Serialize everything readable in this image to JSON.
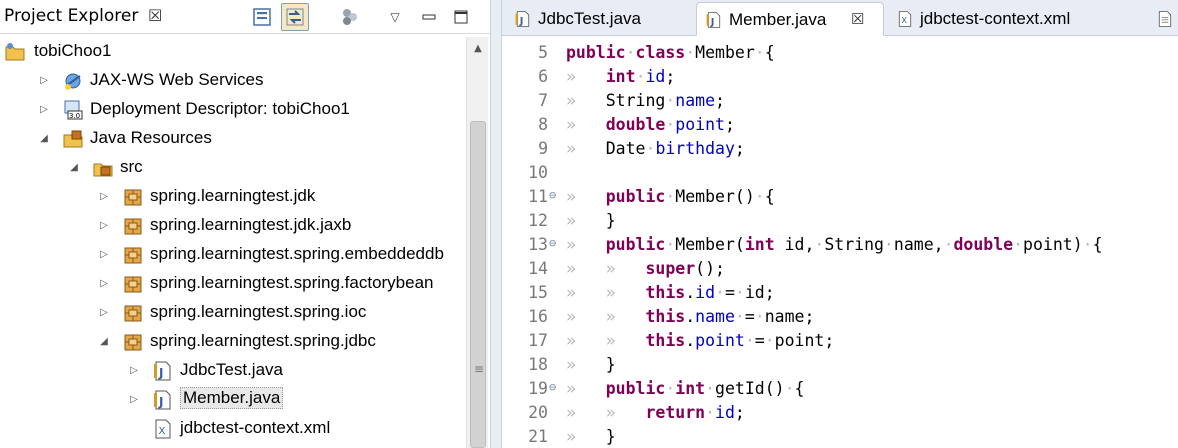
{
  "explorer": {
    "title": "Project Explorer",
    "close_glyph": "☒",
    "view_menu_glyph": "▽",
    "tree": [
      {
        "label": "tobiChoo1",
        "icon": "project-icon",
        "depth": 0,
        "twisty": "",
        "selected": false
      },
      {
        "label": "JAX-WS Web Services",
        "icon": "webservices-icon",
        "depth": 1,
        "twisty": "▷",
        "selected": false
      },
      {
        "label": "Deployment Descriptor: tobiChoo1",
        "icon": "deployment-descriptor-icon",
        "depth": 1,
        "twisty": "▷",
        "selected": false
      },
      {
        "label": "Java Resources",
        "icon": "java-resources-icon",
        "depth": 1,
        "twisty": "◢",
        "selected": false
      },
      {
        "label": "src",
        "icon": "source-folder-icon",
        "depth": 2,
        "twisty": "◢",
        "selected": false
      },
      {
        "label": "spring.learningtest.jdk",
        "icon": "package-icon",
        "depth": 3,
        "twisty": "▷",
        "selected": false
      },
      {
        "label": "spring.learningtest.jdk.jaxb",
        "icon": "package-icon",
        "depth": 3,
        "twisty": "▷",
        "selected": false
      },
      {
        "label": "spring.learningtest.spring.embeddeddb",
        "icon": "package-icon",
        "depth": 3,
        "twisty": "▷",
        "selected": false
      },
      {
        "label": "spring.learningtest.spring.factorybean",
        "icon": "package-icon",
        "depth": 3,
        "twisty": "▷",
        "selected": false
      },
      {
        "label": "spring.learningtest.spring.ioc",
        "icon": "package-icon",
        "depth": 3,
        "twisty": "▷",
        "selected": false
      },
      {
        "label": "spring.learningtest.spring.jdbc",
        "icon": "package-icon",
        "depth": 3,
        "twisty": "◢",
        "selected": false
      },
      {
        "label": "JdbcTest.java",
        "icon": "java-file-icon",
        "depth": 4,
        "twisty": "▷",
        "selected": false
      },
      {
        "label": "Member.java",
        "icon": "java-file-icon",
        "depth": 4,
        "twisty": "▷",
        "selected": true
      },
      {
        "label": "jdbctest-context.xml",
        "icon": "xml-file-icon",
        "depth": 4,
        "twisty": "",
        "selected": false
      }
    ],
    "scroll_glyph": "▲",
    "grip_glyph": "≡"
  },
  "editor": {
    "tabs": [
      {
        "label": "JdbcTest.java",
        "icon": "java-file-icon",
        "active": false
      },
      {
        "label": "Member.java",
        "icon": "java-file-icon",
        "active": true,
        "close_glyph": "☒"
      },
      {
        "label": "jdbctest-context.xml",
        "icon": "xml-file-icon",
        "active": false
      },
      {
        "label": "",
        "icon": "text-file-icon",
        "active": false
      }
    ],
    "lines": [
      {
        "number": "5",
        "fold": "",
        "tokens": [
          {
            "t": "kw",
            "s": "public"
          },
          {
            "t": "ws",
            "s": "·"
          },
          {
            "t": "kw",
            "s": "class"
          },
          {
            "t": "ws",
            "s": "·"
          },
          {
            "t": "plain",
            "s": "Member"
          },
          {
            "t": "ws",
            "s": "·"
          },
          {
            "t": "plain",
            "s": "{"
          }
        ]
      },
      {
        "number": "6",
        "fold": "",
        "tokens": [
          {
            "t": "ws",
            "s": "»   "
          },
          {
            "t": "kw",
            "s": "int"
          },
          {
            "t": "ws",
            "s": "·"
          },
          {
            "t": "fld",
            "s": "id"
          },
          {
            "t": "plain",
            "s": ";"
          }
        ]
      },
      {
        "number": "7",
        "fold": "",
        "tokens": [
          {
            "t": "ws",
            "s": "»   "
          },
          {
            "t": "plain",
            "s": "String"
          },
          {
            "t": "ws",
            "s": "·"
          },
          {
            "t": "fld",
            "s": "name"
          },
          {
            "t": "plain",
            "s": ";"
          }
        ]
      },
      {
        "number": "8",
        "fold": "",
        "tokens": [
          {
            "t": "ws",
            "s": "»   "
          },
          {
            "t": "kw",
            "s": "double"
          },
          {
            "t": "ws",
            "s": "·"
          },
          {
            "t": "fld",
            "s": "point"
          },
          {
            "t": "plain",
            "s": ";"
          }
        ]
      },
      {
        "number": "9",
        "fold": "",
        "tokens": [
          {
            "t": "ws",
            "s": "»   "
          },
          {
            "t": "plain",
            "s": "Date"
          },
          {
            "t": "ws",
            "s": "·"
          },
          {
            "t": "fld",
            "s": "birthday"
          },
          {
            "t": "plain",
            "s": ";"
          }
        ]
      },
      {
        "number": "10",
        "fold": "",
        "tokens": []
      },
      {
        "number": "11",
        "fold": "⊖",
        "tokens": [
          {
            "t": "ws",
            "s": "»   "
          },
          {
            "t": "kw",
            "s": "public"
          },
          {
            "t": "ws",
            "s": "·"
          },
          {
            "t": "plain",
            "s": "Member()"
          },
          {
            "t": "ws",
            "s": "·"
          },
          {
            "t": "plain",
            "s": "{"
          }
        ]
      },
      {
        "number": "12",
        "fold": "",
        "tokens": [
          {
            "t": "ws",
            "s": "»   "
          },
          {
            "t": "plain",
            "s": "}"
          }
        ]
      },
      {
        "number": "13",
        "fold": "⊖",
        "tokens": [
          {
            "t": "ws",
            "s": "»   "
          },
          {
            "t": "kw",
            "s": "public"
          },
          {
            "t": "ws",
            "s": "·"
          },
          {
            "t": "plain",
            "s": "Member("
          },
          {
            "t": "kw",
            "s": "int"
          },
          {
            "t": "plain",
            "s": " id,"
          },
          {
            "t": "ws",
            "s": "·"
          },
          {
            "t": "plain",
            "s": "String"
          },
          {
            "t": "ws",
            "s": "·"
          },
          {
            "t": "plain",
            "s": "name,"
          },
          {
            "t": "ws",
            "s": "·"
          },
          {
            "t": "kw",
            "s": "double"
          },
          {
            "t": "ws",
            "s": "·"
          },
          {
            "t": "plain",
            "s": "point)"
          },
          {
            "t": "ws",
            "s": "·"
          },
          {
            "t": "plain",
            "s": "{"
          }
        ]
      },
      {
        "number": "14",
        "fold": "",
        "tokens": [
          {
            "t": "ws",
            "s": "»   »   "
          },
          {
            "t": "kw",
            "s": "super"
          },
          {
            "t": "plain",
            "s": "();"
          }
        ]
      },
      {
        "number": "15",
        "fold": "",
        "tokens": [
          {
            "t": "ws",
            "s": "»   »   "
          },
          {
            "t": "kw",
            "s": "this"
          },
          {
            "t": "plain",
            "s": "."
          },
          {
            "t": "fld",
            "s": "id"
          },
          {
            "t": "ws",
            "s": "·"
          },
          {
            "t": "plain",
            "s": "="
          },
          {
            "t": "ws",
            "s": "·"
          },
          {
            "t": "plain",
            "s": "id;"
          }
        ]
      },
      {
        "number": "16",
        "fold": "",
        "tokens": [
          {
            "t": "ws",
            "s": "»   »   "
          },
          {
            "t": "kw",
            "s": "this"
          },
          {
            "t": "plain",
            "s": "."
          },
          {
            "t": "fld",
            "s": "name"
          },
          {
            "t": "ws",
            "s": "·"
          },
          {
            "t": "plain",
            "s": "="
          },
          {
            "t": "ws",
            "s": "·"
          },
          {
            "t": "plain",
            "s": "name;"
          }
        ]
      },
      {
        "number": "17",
        "fold": "",
        "tokens": [
          {
            "t": "ws",
            "s": "»   »   "
          },
          {
            "t": "kw",
            "s": "this"
          },
          {
            "t": "plain",
            "s": "."
          },
          {
            "t": "fld",
            "s": "point"
          },
          {
            "t": "ws",
            "s": "·"
          },
          {
            "t": "plain",
            "s": "="
          },
          {
            "t": "ws",
            "s": "·"
          },
          {
            "t": "plain",
            "s": "point;"
          }
        ]
      },
      {
        "number": "18",
        "fold": "",
        "tokens": [
          {
            "t": "ws",
            "s": "»   "
          },
          {
            "t": "plain",
            "s": "}"
          }
        ]
      },
      {
        "number": "19",
        "fold": "⊖",
        "tokens": [
          {
            "t": "ws",
            "s": "»   "
          },
          {
            "t": "kw",
            "s": "public"
          },
          {
            "t": "ws",
            "s": "·"
          },
          {
            "t": "kw",
            "s": "int"
          },
          {
            "t": "ws",
            "s": "·"
          },
          {
            "t": "plain",
            "s": "getId()"
          },
          {
            "t": "ws",
            "s": "·"
          },
          {
            "t": "plain",
            "s": "{"
          }
        ]
      },
      {
        "number": "20",
        "fold": "",
        "tokens": [
          {
            "t": "ws",
            "s": "»   »   "
          },
          {
            "t": "kw",
            "s": "return"
          },
          {
            "t": "ws",
            "s": "·"
          },
          {
            "t": "fld",
            "s": "id"
          },
          {
            "t": "plain",
            "s": ";"
          }
        ]
      },
      {
        "number": "21",
        "fold": "",
        "tokens": [
          {
            "t": "ws",
            "s": "»   "
          },
          {
            "t": "plain",
            "s": "}"
          }
        ]
      }
    ]
  },
  "colors": {
    "keyword": "#7f0055",
    "field": "#0000c0",
    "whitespace_marker": "#b8b8b8",
    "line_number": "#787878"
  }
}
